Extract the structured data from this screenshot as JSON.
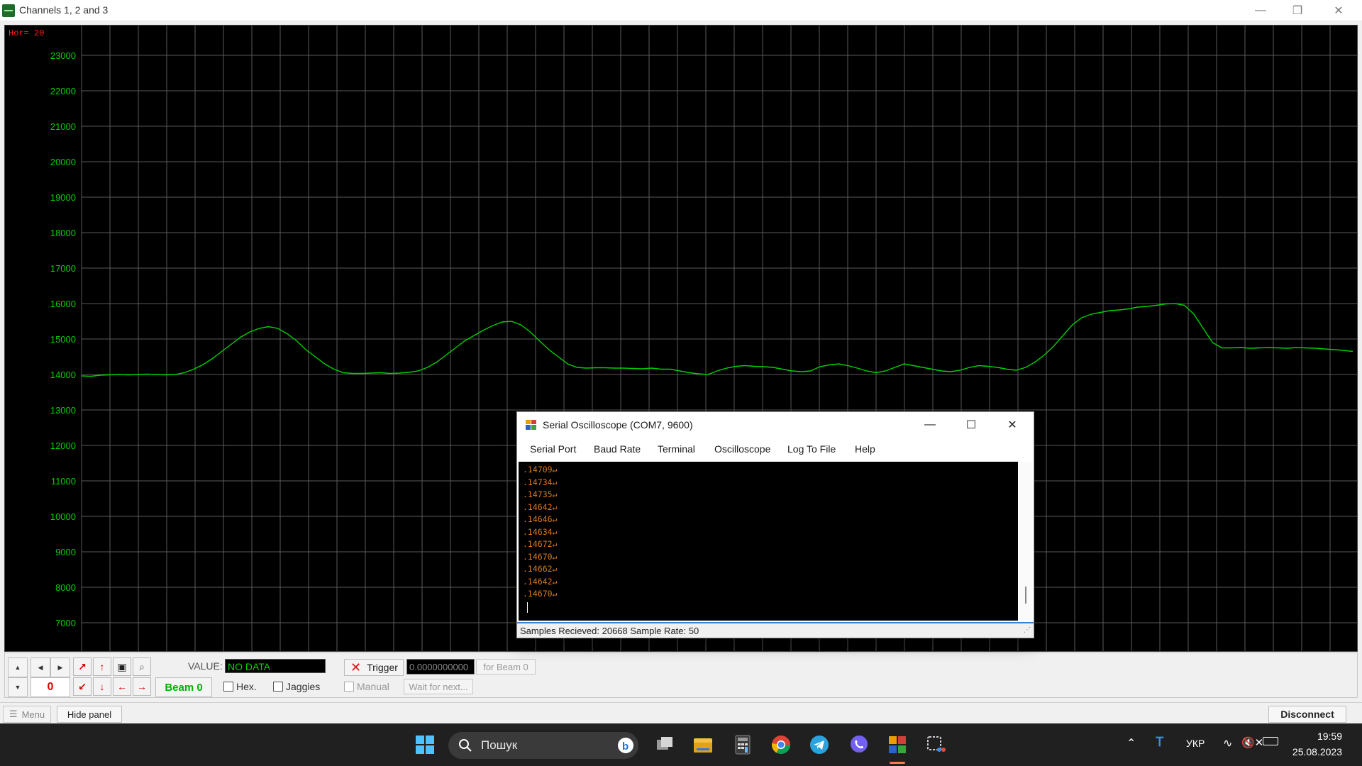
{
  "window": {
    "title": "Channels 1, 2 and 3"
  },
  "scope": {
    "hor_label": "Hor= 20",
    "y_ticks": [
      "23000",
      "22000",
      "21000",
      "20000",
      "19000",
      "18000",
      "17000",
      "16000",
      "15000",
      "14000",
      "13000",
      "12000",
      "11000",
      "10000",
      "9000",
      "8000",
      "7000"
    ],
    "trace_color": "#00d000",
    "axis_label_color": "#00d000",
    "grid_color": "#5a5a5a",
    "trace_values": [
      13960,
      13950,
      13980,
      13990,
      14000,
      13990,
      14000,
      14010,
      14000,
      13990,
      14000,
      14050,
      14150,
      14280,
      14450,
      14650,
      14850,
      15050,
      15200,
      15300,
      15350,
      15300,
      15150,
      14950,
      14700,
      14500,
      14300,
      14150,
      14050,
      14030,
      14030,
      14040,
      14050,
      14030,
      14040,
      14060,
      14100,
      14200,
      14350,
      14550,
      14750,
      14950,
      15100,
      15250,
      15380,
      15480,
      15500,
      15400,
      15200,
      14950,
      14700,
      14500,
      14300,
      14200,
      14180,
      14190,
      14190,
      14180,
      14180,
      14170,
      14160,
      14180,
      14150,
      14150,
      14100,
      14050,
      14020,
      14000,
      14100,
      14180,
      14230,
      14250,
      14230,
      14220,
      14200,
      14150,
      14100,
      14080,
      14100,
      14220,
      14270,
      14300,
      14250,
      14180,
      14100,
      14050,
      14100,
      14200,
      14300,
      14250,
      14200,
      14150,
      14100,
      14080,
      14120,
      14200,
      14250,
      14230,
      14200,
      14150,
      14120,
      14200,
      14350,
      14550,
      14800,
      15100,
      15400,
      15600,
      15700,
      15750,
      15800,
      15820,
      15850,
      15900,
      15920,
      15950,
      15990,
      16000,
      15950,
      15700,
      15300,
      14900,
      14750,
      14750,
      14760,
      14740,
      14750,
      14760,
      14750,
      14740,
      14760,
      14750,
      14740,
      14720,
      14700,
      14680,
      14650
    ]
  },
  "controls": {
    "counter": "0",
    "beam_label": "Beam 0",
    "value_label": "VALUE:",
    "value_display": "NO DATA",
    "hex_label": "Hex.",
    "jaggies_label": "Jaggies",
    "trigger_label": "Trigger",
    "trigger_value": "0.0000000000",
    "for_beam_label": "for Beam 0",
    "manual_label": "Manual",
    "wait_label": "Wait for next..."
  },
  "bottom_bar": {
    "menu_label": "Menu",
    "hide_panel_label": "Hide panel",
    "disconnect_label": "Disconnect"
  },
  "serial_window": {
    "title": "Serial Oscilloscope (COM7, 9600)",
    "menu": [
      "Serial Port",
      "Baud Rate",
      "Terminal",
      "Oscilloscope",
      "Log To File",
      "Help"
    ],
    "terminal_lines": [
      ".14709↵",
      ".14734↵",
      ".14735↵",
      ".14642↵",
      ".14646↵",
      ".14634↵",
      ".14672↵",
      ".14670↵",
      ".14662↵",
      ".14642↵",
      ".14670↵"
    ],
    "status": "Samples Recieved: 20668   Sample Rate: 50",
    "terminal_text_color": "#e07a15"
  },
  "taskbar": {
    "search_placeholder": "Пошук",
    "language": "УКР",
    "time": "19:59",
    "date": "25.08.2023",
    "apps": [
      "windows-start-icon",
      "task-view-icon",
      "file-explorer-icon",
      "calculator-icon",
      "chrome-icon",
      "telegram-icon",
      "viber-icon",
      "serial-oscilloscope-icon",
      "snipping-tool-icon"
    ]
  }
}
